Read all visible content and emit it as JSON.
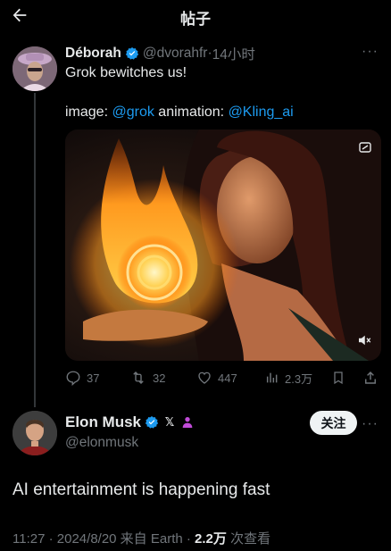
{
  "header": {
    "title": "帖子"
  },
  "parent_tweet": {
    "name": "Déborah",
    "handle": "@dvorahfr",
    "separator": "·",
    "time": "14小时",
    "line1": "Grok bewitches us!",
    "line2_prefix": "image: ",
    "mention1": "@grok",
    "line2_mid": " animation: ",
    "mention2": "@Kling_ai",
    "more": "···",
    "stats": {
      "replies": "37",
      "reposts": "32",
      "likes": "447",
      "views": "2.3万"
    }
  },
  "main_tweet": {
    "name": "Elon Musk",
    "handle": "@elonmusk",
    "follow_label": "关注",
    "more": "···",
    "text": "AI entertainment is happening fast",
    "time": "11:27",
    "separator1": "·",
    "date": "2024/8/20 来自 Earth",
    "separator2": "·",
    "views_count": "2.2万",
    "views_label": "次查看"
  },
  "colors": {
    "background": "#000000",
    "text": "#e7e9ea",
    "muted": "#71767b",
    "link": "#1d9bf0",
    "verified": "#1d9bf0",
    "affiliate": "#c14bd8"
  },
  "icons": [
    "back-arrow-icon",
    "verified-badge-icon",
    "more-icon",
    "gif-icon",
    "mute-icon",
    "reply-icon",
    "repost-icon",
    "like-icon",
    "views-icon",
    "bookmark-icon",
    "share-icon",
    "x-logo-icon",
    "affiliate-icon"
  ]
}
